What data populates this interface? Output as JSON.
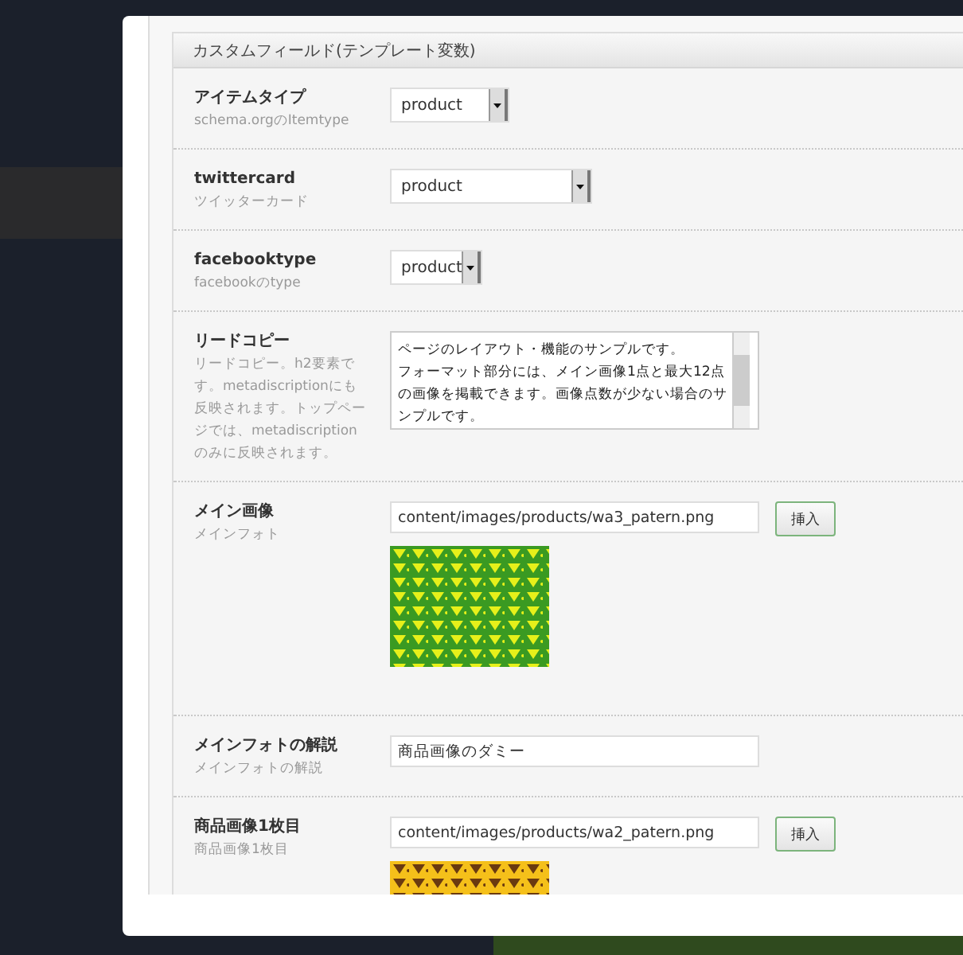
{
  "panel": {
    "title": "カスタムフィールド(テンプレート変数)"
  },
  "fields": [
    {
      "kind": "select",
      "label": "アイテムタイプ",
      "description": "schema.orgのItemtype",
      "value": "product"
    },
    {
      "kind": "select",
      "label": "twittercard",
      "description": "ツイッターカード",
      "value": "product"
    },
    {
      "kind": "select",
      "label": "facebooktype",
      "description": "facebookのtype",
      "value": "product"
    },
    {
      "kind": "textarea",
      "label": "リードコピー",
      "description": "リードコピー。h2要素です。metadiscriptionにも反映されます。トップページでは、metadiscriptionのみに反映されます。",
      "paragraphs": [
        "ページのレイアウト・機能のサンプルです。",
        "フォーマット部分には、メイン画像1点と最大12点の画像を掲載できます。画像点数が少ない場合のサンプルです。"
      ]
    },
    {
      "kind": "image",
      "label": "メイン画像",
      "description": "メインフォト",
      "value": "content/images/products/wa3_patern.png",
      "button": "挿入",
      "preview": {
        "color": "#3a9a22"
      }
    },
    {
      "kind": "text",
      "label": "メインフォトの解説",
      "description": "メインフォトの解説",
      "value": "商品画像のダミー"
    },
    {
      "kind": "image",
      "label": "商品画像1枚目",
      "description": "商品画像1枚目",
      "value": "content/images/products/wa2_patern.png",
      "button": "挿入",
      "preview": {
        "color": "#f5c01a"
      }
    }
  ]
}
